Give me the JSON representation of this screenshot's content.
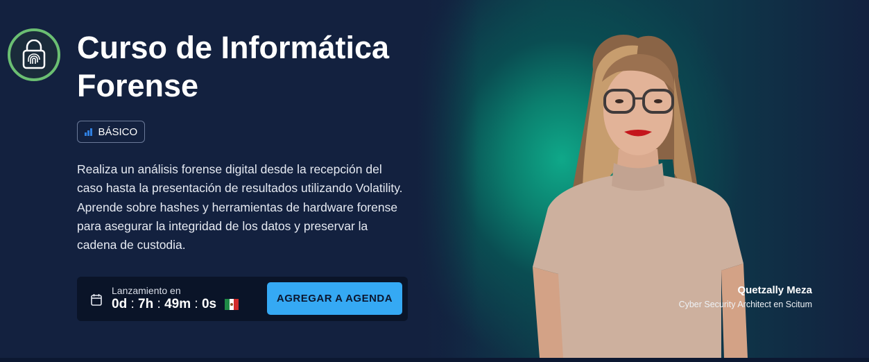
{
  "course": {
    "title": "Curso de Informática Forense",
    "level": "BÁSICO",
    "description": "Realiza un análisis forense digital desde la recepción del caso hasta la presentación de resultados utilizando Volatility. Aprende sobre hashes y herramientas de hardware forense para asegurar la integridad de los datos y preservar la cadena de custodia."
  },
  "launch": {
    "label": "Lanzamiento en",
    "days": "0d",
    "hours": "7h",
    "minutes": "49m",
    "seconds": "0s",
    "separator": ":",
    "flag_icon": "mexico-flag-icon",
    "calendar_icon": "calendar-icon",
    "button_label": "AGREGAR A AGENDA"
  },
  "instructor": {
    "name": "Quetzally Meza",
    "role": "Cyber Security Architect en Scitum"
  },
  "icons": {
    "logo": "fingerprint-lock-icon",
    "level": "signal-bars-icon"
  },
  "colors": {
    "background": "#13213f",
    "accent": "#35a9f4",
    "logo_ring": "#6bbf72",
    "teal_glow": "#0fa889"
  }
}
